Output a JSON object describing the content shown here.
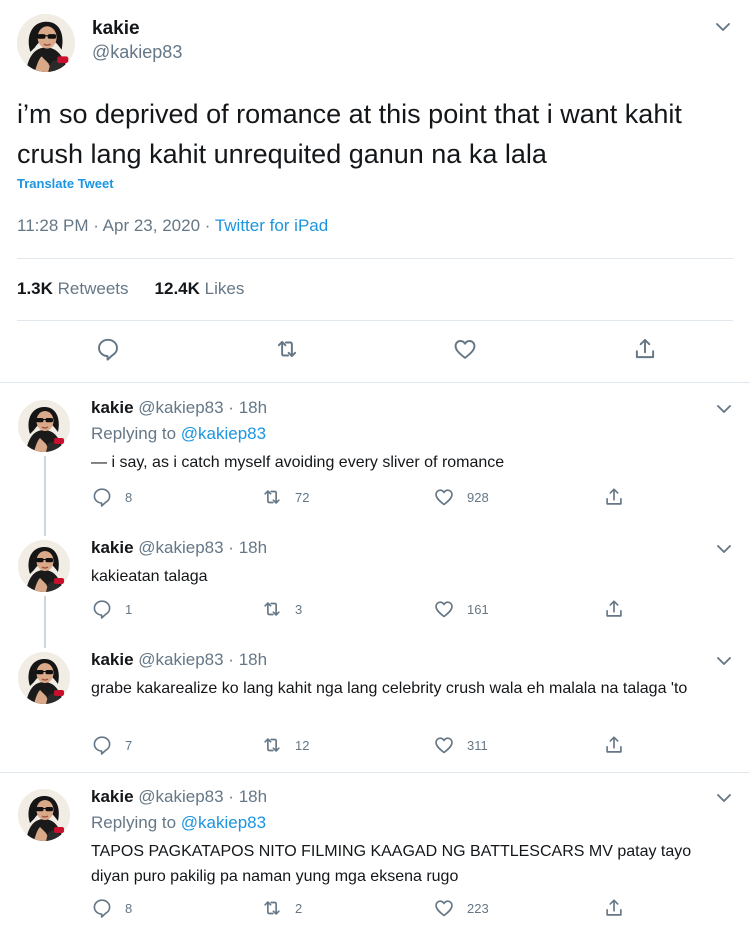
{
  "main": {
    "name": "kakie",
    "handle": "@kakiep83",
    "text": "i’m so deprived of romance at this point that i want kahit crush lang kahit unrequited ganun na ka lala",
    "translate": "Translate Tweet",
    "time": "11:28 PM · Apr 23, 2020 · ",
    "source": "Twitter for iPad",
    "retweets_count": "1.3K",
    "retweets_label": "Retweets",
    "likes_count": "12.4K",
    "likes_label": "Likes"
  },
  "replies": [
    {
      "name": "kakie",
      "meta": "@kakiep83 · 18h",
      "replying_prefix": "Replying to ",
      "replying_link": "@kakiep83",
      "text": "— i say, as i catch myself avoiding every sliver of romance",
      "replies": "8",
      "retweets": "72",
      "likes": "928"
    },
    {
      "name": "kakie",
      "meta": "@kakiep83 · 18h",
      "text": "kakieatan talaga",
      "replies": "1",
      "retweets": "3",
      "likes": "161"
    },
    {
      "name": "kakie",
      "meta": "@kakiep83 · 18h",
      "text": "grabe kakarealize ko lang kahit nga lang celebrity crush wala eh malala na talaga 'to",
      "replies": "7",
      "retweets": "12",
      "likes": "311"
    },
    {
      "name": "kakie",
      "meta": "@kakiep83 · 18h",
      "replying_prefix": "Replying to ",
      "replying_link": "@kakiep83",
      "text": "TAPOS PAGKATAPOS NITO FILMING KAAGAD NG BATTLESCARS MV patay tayo diyan puro pakilig pa naman yung mga eksena rugo",
      "replies": "8",
      "retweets": "2",
      "likes": "223"
    }
  ],
  "icons": {
    "reply": "speech-bubble-icon",
    "retweet": "retweet-icon",
    "like": "heart-icon",
    "share": "share-icon",
    "menu": "chevron-down-icon"
  },
  "colors": {
    "link": "#1b95e0",
    "muted": "#657786",
    "text": "#14171a",
    "divider": "#e1e8ed"
  }
}
